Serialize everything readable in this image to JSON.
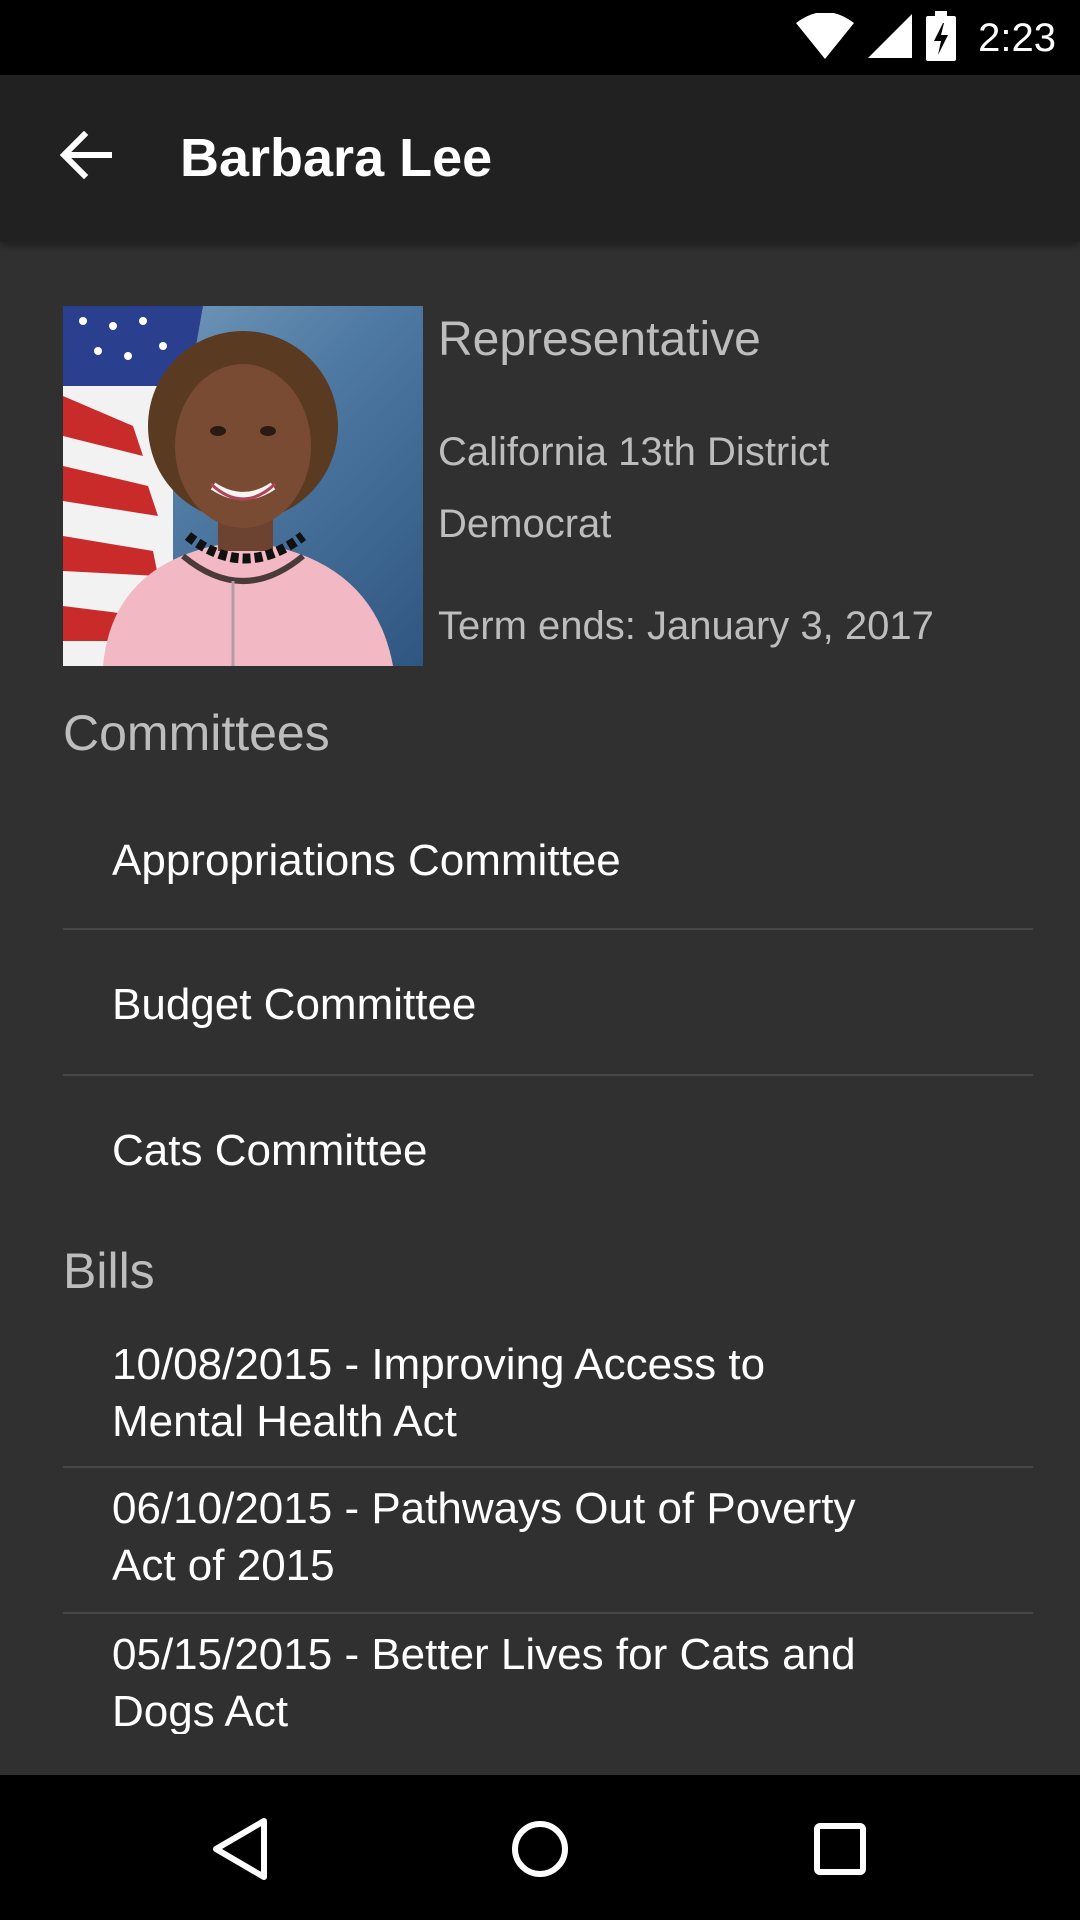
{
  "status_bar": {
    "time": "2:23"
  },
  "app_bar": {
    "title": "Barbara Lee"
  },
  "profile": {
    "role": "Representative",
    "district": "California 13th District",
    "party": "Democrat",
    "term": "Term ends: January 3, 2017"
  },
  "committees": {
    "header": "Committees",
    "items": [
      "Appropriations Committee",
      "Budget Committee",
      "Cats Committee"
    ]
  },
  "bills": {
    "header": "Bills",
    "items": [
      {
        "line1": "10/08/2015 - Improving Access to",
        "line2": "Mental Health Act"
      },
      {
        "line1": "06/10/2015 - Pathways Out of Poverty",
        "line2": "Act of 2015"
      },
      {
        "line1": "05/15/2015 - Better Lives for Cats and",
        "line2": "Dogs Act"
      }
    ]
  },
  "icons": {
    "back": "arrow-left-icon",
    "wifi": "wifi-icon",
    "signal": "cell-signal-icon",
    "battery": "battery-charging-icon",
    "nav_back": "triangle-back-icon",
    "nav_home": "circle-home-icon",
    "nav_recents": "square-recents-icon"
  },
  "colors": {
    "background": "#303030",
    "app_bar": "#212121",
    "secondary_text": "#bdbdbd"
  }
}
